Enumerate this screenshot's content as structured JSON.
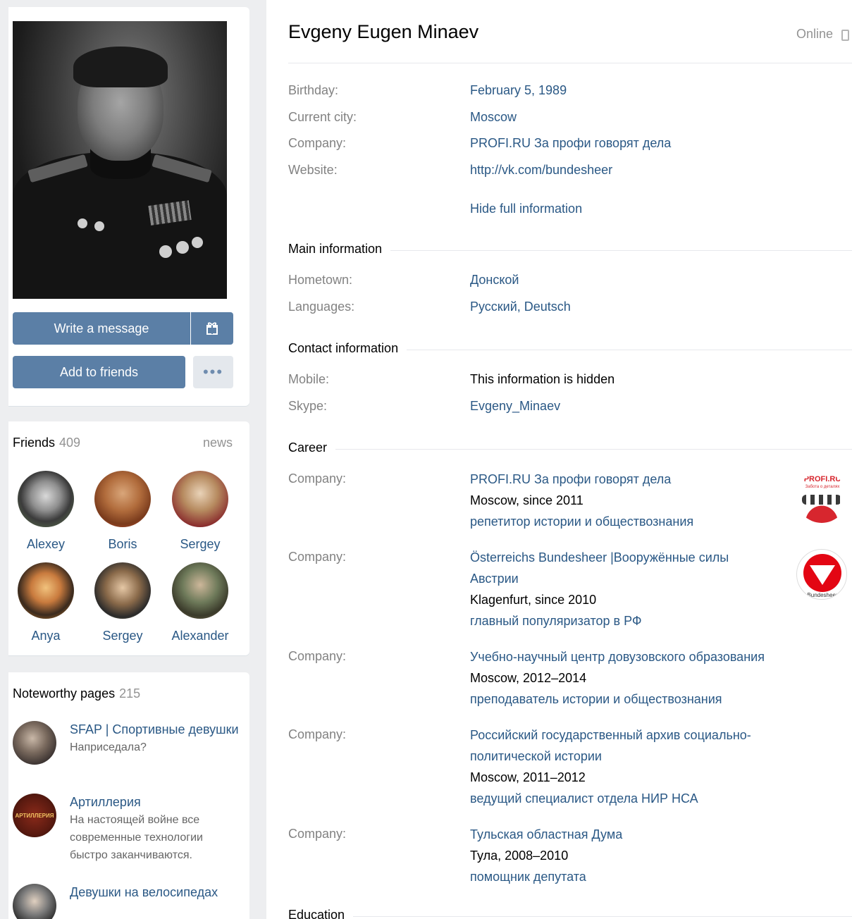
{
  "profile": {
    "name": "Evgeny Eugen Minaev",
    "status": "Online"
  },
  "actions": {
    "write_message": "Write a message",
    "add_friends": "Add to friends",
    "more": "•••"
  },
  "info": [
    {
      "label": "Birthday:",
      "value": "February 5, 1989"
    },
    {
      "label": "Current city:",
      "value": "Moscow"
    },
    {
      "label": "Company:",
      "value": "PROFI.RU За профи говорят дела"
    },
    {
      "label": "Website:",
      "value": "http://vk.com/bundesheer"
    }
  ],
  "hide_link": "Hide full information",
  "main_information": {
    "title": "Main information",
    "rows": [
      {
        "label": "Hometown:",
        "value": "Донской"
      },
      {
        "label": "Languages:",
        "value": "Русский, Deutsch"
      }
    ]
  },
  "contact_information": {
    "title": "Contact information",
    "rows": [
      {
        "label": "Mobile:",
        "value": "This information is hidden"
      },
      {
        "label": "Skype:",
        "value": "Evgeny_Minaev"
      }
    ]
  },
  "career": {
    "title": "Career",
    "label": "Company:",
    "items": [
      {
        "company_line1": "PROFI.RU За профи говорят дела",
        "company_line2": "",
        "place": "Moscow, since 2011",
        "position": "репетитор истории и обществознания",
        "logo_text": "PROFI.RU",
        "logo_sub": "Забота о деталях"
      },
      {
        "company_line1": "Österreichs Bundesheer |Вооружённые силы",
        "company_line2": "Австрии",
        "place": "Klagenfurt, since 2010",
        "position": "главный популяризатор в РФ",
        "logo_text": "Bundesheer"
      },
      {
        "company_line1": "Учебно-научный центр довузовского образования",
        "company_line2": "",
        "place": "Moscow, 2012–2014",
        "position": "преподаватель истории и обществознания"
      },
      {
        "company_line1": "Российский государственный архив социально-",
        "company_line2": "политической истории",
        "place": "Moscow, 2011–2012",
        "position": "ведущий специалист отдела НИР НСА"
      },
      {
        "company_line1": "Тульская областная Дума",
        "company_line2": "",
        "place": "Тула, 2008–2010",
        "position": "помощник депутата"
      }
    ]
  },
  "education": {
    "title": "Education"
  },
  "friends": {
    "title": "Friends",
    "count": "409",
    "news": "news",
    "list": [
      "Alexey",
      "Boris",
      "Sergey",
      "Anya",
      "Sergey",
      "Alexander"
    ]
  },
  "pages": {
    "title": "Noteworthy pages",
    "count": "215",
    "items": [
      {
        "title": "SFAP | Спортивные девушки",
        "desc": "Наприседала?"
      },
      {
        "title": "Артиллерия",
        "desc": "На настоящей войне все современные технологии быстро заканчиваются.",
        "avatar_text": "АРТИЛЛЕРИЯ"
      },
      {
        "title": "Девушки на велосипедах",
        "desc": ""
      }
    ]
  },
  "colors": {
    "link": "#2a5885",
    "button": "#5b7fa6",
    "muted": "#828282"
  }
}
